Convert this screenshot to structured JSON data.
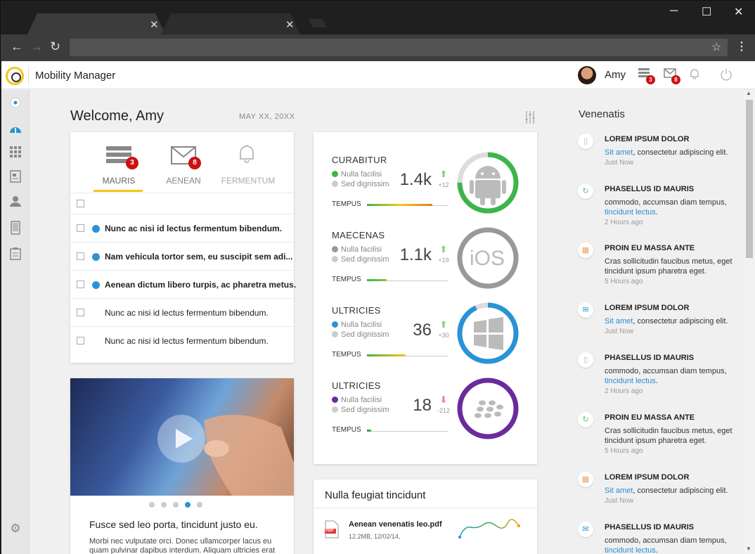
{
  "browser": {
    "tab1_close": "✕",
    "tab2_close": "✕",
    "minimize": "─",
    "maximize": "☐",
    "close": "✕"
  },
  "app": {
    "title": "Mobility Manager",
    "user": "Amy",
    "tasks_badge": "3",
    "mail_badge": "8"
  },
  "welcome": {
    "greeting": "Welcome, Amy",
    "date": "MAY XX, 20XX"
  },
  "inbox": {
    "tabs": [
      {
        "label": "MAURIS",
        "badge": "3"
      },
      {
        "label": "AENEAN",
        "badge": "8"
      },
      {
        "label": "FERMENTUM"
      }
    ],
    "rows": [
      {
        "text": "Nunc ac nisi id lectus fermentum bibendum.",
        "unread": true
      },
      {
        "text": "Nam vehicula tortor sem, eu suscipit sem adi...",
        "unread": true
      },
      {
        "text": "Aenean dictum libero turpis, ac pharetra metus.",
        "unread": true
      },
      {
        "text": "Nunc ac nisi id lectus fermentum bibendum.",
        "unread": false
      },
      {
        "text": "Nunc ac nisi id lectus fermentum bibendum.",
        "unread": false
      }
    ]
  },
  "video": {
    "caption": "Fusce sed leo porta, tincidunt justo eu.",
    "body": "Morbi nec vulputate orci. Donec ullamcorper lacus eu quam pulvinar dapibus interdum. Aliquam ultricies erat",
    "active_dot": 3
  },
  "stats": [
    {
      "title": "CURABITUR",
      "leg1": "Nulla facilisi",
      "leg2": "Sed dignissim",
      "value": "1.4k",
      "delta": "+12",
      "dir": "up",
      "tempus": "TEMPUS",
      "os": "android",
      "color": "#3cb54a",
      "ring_pct": 0.75,
      "bar_pct": 0.8
    },
    {
      "title": "MAECENAS",
      "leg1": "Nulla facilisi",
      "leg2": "Sed dignissim",
      "value": "1.1k",
      "delta": "+19",
      "dir": "up",
      "tempus": "TEMPUS",
      "os": "iOS",
      "color": "#999999",
      "ring_pct": 1.0,
      "bar_pct": 0.24
    },
    {
      "title": "ULTRICIES",
      "leg1": "Nulla facilisi",
      "leg2": "Sed dignissim",
      "value": "36",
      "delta": "+30",
      "dir": "up",
      "tempus": "TEMPUS",
      "os": "windows",
      "color": "#2a93d5",
      "ring_pct": 0.93,
      "bar_pct": 0.47
    },
    {
      "title": "ULTRICIES",
      "leg1": "Nulla facilisi",
      "leg2": "Sed dignissim",
      "value": "18",
      "delta": "-212",
      "dir": "down",
      "tempus": "TEMPUS",
      "os": "blackberry",
      "color": "#6b2b9c",
      "ring_pct": 1.0,
      "bar_pct": 0.05
    }
  ],
  "files": {
    "title": "Nulla feugiat tincidunt",
    "file_name": "Aenean venenatis leo.pdf",
    "file_meta": "12.2MB, 12/02/14,",
    "file_type": "PDF"
  },
  "feed": {
    "title": "Venenatis",
    "items": [
      {
        "icon": "phone",
        "head": "LOREM IPSUM DOLOR",
        "link": "Sit amet",
        "body": ", consectetur adipiscing elit.",
        "time": "Just Now"
      },
      {
        "icon": "sync",
        "head": "PHASELLUS ID MAURIS",
        "body": "commodo, accumsan diam tempus,",
        "link2": "tincidunt lectus",
        "tail": ".",
        "time": "2 Hours ago"
      },
      {
        "icon": "calendar",
        "head": "PROIN EU MASSA ANTE",
        "body": "Cras sollicitudin faucibus metus, eget tincidunt ipsum pharetra eget.",
        "time": "5 Hours ago"
      },
      {
        "icon": "mail",
        "head": "LOREM IPSUM DOLOR",
        "link": "Sit amet",
        "body": ", consectetur adipiscing elit.",
        "time": "Just Now"
      },
      {
        "icon": "phone",
        "head": "PHASELLUS ID MAURIS",
        "body": "commodo, accumsan diam tempus,",
        "link2": "tincidunt lectus",
        "tail": ".",
        "time": "2 Hours ago"
      },
      {
        "icon": "sync",
        "head": "PROIN EU MASSA ANTE",
        "body": "Cras sollicitudin faucibus metus, eget tincidunt ipsum pharetra eget.",
        "time": "5 Hours ago"
      },
      {
        "icon": "calendar",
        "head": "LOREM IPSUM DOLOR",
        "link": "Sit amet",
        "body": ", consectetur adipiscing elit.",
        "time": "Just Now"
      },
      {
        "icon": "mail",
        "head": "PHASELLUS ID MAURIS",
        "body": "commodo, accumsan diam tempus,",
        "link2": "tincidunt lectus",
        "tail": ".",
        "time": ""
      }
    ]
  }
}
